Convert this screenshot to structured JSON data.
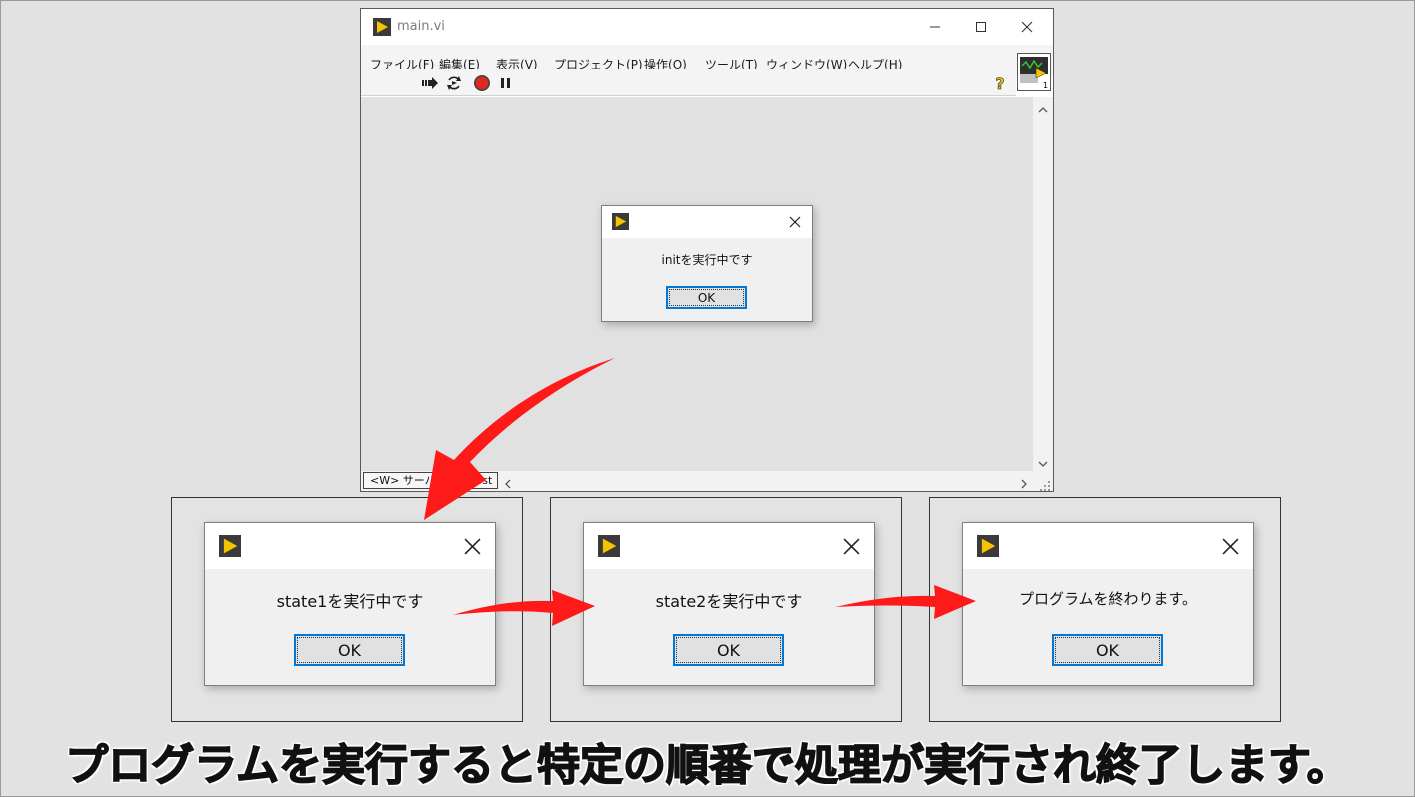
{
  "window": {
    "title": "main.vi",
    "menu": [
      {
        "label": "ファイル",
        "mnemonic": "(F)"
      },
      {
        "label": "編集",
        "mnemonic": "(E)"
      },
      {
        "label": "表示",
        "mnemonic": "(V)"
      },
      {
        "label": "プロジェクト",
        "mnemonic": "(P)"
      },
      {
        "label": "操作",
        "mnemonic": "(O)"
      },
      {
        "label": "ツール",
        "mnemonic": "(T)"
      },
      {
        "label": "ウィンドウ",
        "mnemonic": "(W)"
      },
      {
        "label": "ヘルプ",
        "mnemonic": "(H)"
      }
    ],
    "status_tab": "<W> サーバ: localhost",
    "connector_number": "1"
  },
  "dialogs": {
    "init": {
      "message": "initを実行中です",
      "ok_label": "OK"
    },
    "state1": {
      "message": "state1を実行中です",
      "ok_label": "OK"
    },
    "state2": {
      "message": "state2を実行中です",
      "ok_label": "OK"
    },
    "end": {
      "message": "プログラムを終わります。",
      "ok_label": "OK"
    }
  },
  "caption": "プログラムを実行すると特定の順番で処理が実行され終了します。",
  "colors": {
    "arrow": "#ff1a1a",
    "button_focus": "#0078d7",
    "labview_icon_yellow": "#f5c400",
    "labview_icon_dark": "#3a3a3a"
  }
}
